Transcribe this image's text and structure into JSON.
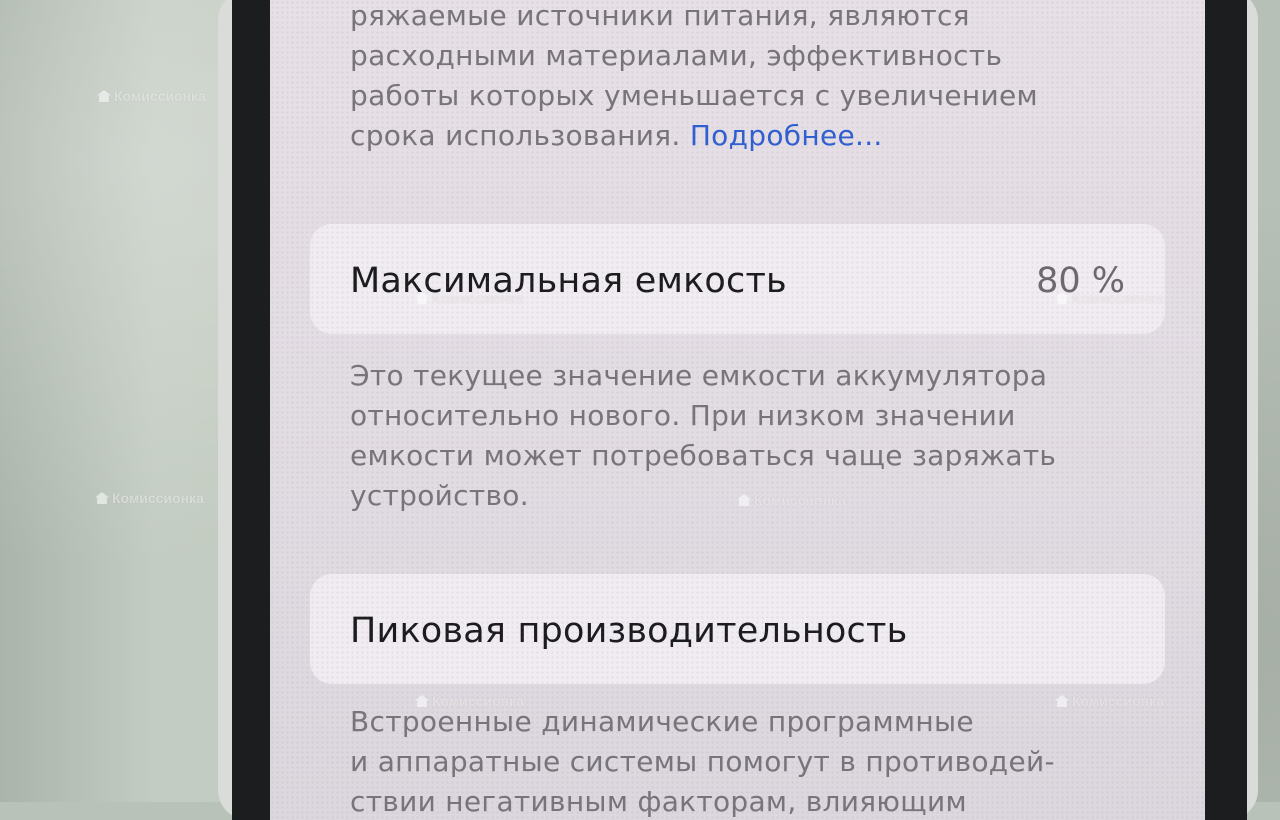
{
  "screen": {
    "intro": {
      "line1": "ряжаемые источники питания, являются",
      "line2": "расходными материалами, эффективность",
      "line3": "работы которых уменьшается с увеличением",
      "line4": "срока использования.",
      "link": "Подробнее..."
    },
    "max_capacity": {
      "label": "Максимальная емкость",
      "value": "80 %",
      "description": {
        "line1": "Это текущее значение емкости аккумулятора",
        "line2": "относительно нового. При низком значении",
        "line3": "емкости может потребоваться чаще заряжать",
        "line4": "устройство."
      }
    },
    "peak_performance": {
      "label": "Пиковая производительность",
      "description": {
        "line1": "Встроенные динамические программные",
        "line2": "и аппаратные системы помогут в противодей-",
        "line3": "ствии негативным факторам, влияющим"
      }
    }
  },
  "watermark": {
    "text": "Комиссионка"
  },
  "colors": {
    "link": "#2f5fd0",
    "card": "#f1ecf1",
    "bezel": "#1c1d1f"
  }
}
